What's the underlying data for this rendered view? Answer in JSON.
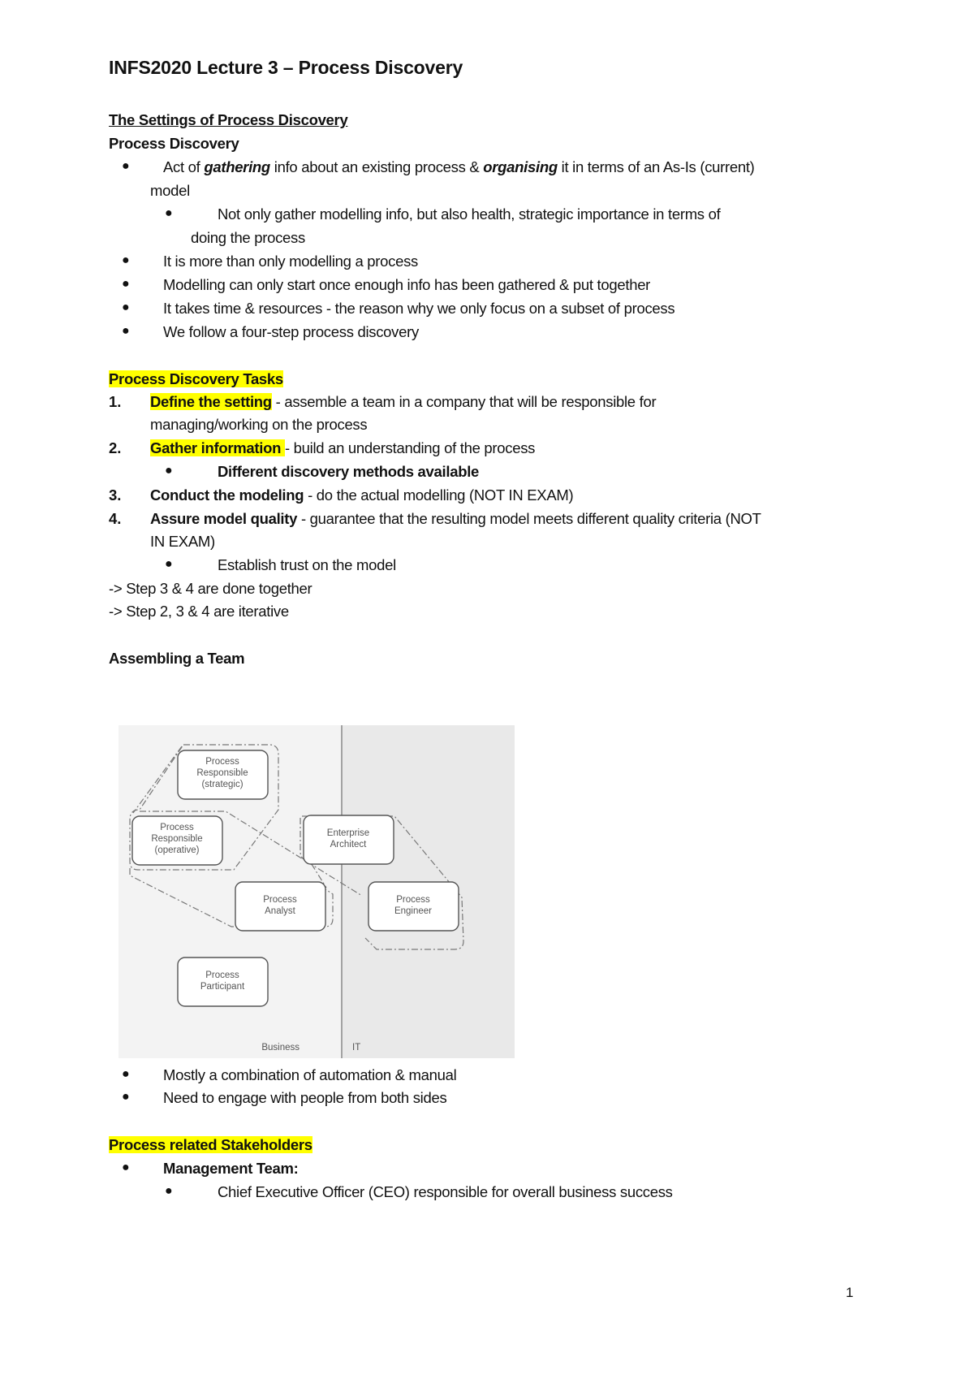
{
  "title": "INFS2020 Lecture 3 – Process Discovery",
  "section1": {
    "heading": "The Settings of Process Discovery",
    "subheading": "Process Discovery",
    "bullets": [
      {
        "parts": [
          "Act of ",
          "gathering",
          " info about an existing process & ",
          "organising",
          " it in terms of an As-Is (current)"
        ],
        "cont": "model",
        "sub": {
          "line1": "Not only gather modelling info, but also health, strategic importance in terms of",
          "line2": "doing the process"
        }
      },
      {
        "text": "It is more than only modelling a process"
      },
      {
        "text": "Modelling can only start once enough info has been gathered & put together"
      },
      {
        "text": "It takes time & resources - the reason why we only focus on a subset of process"
      },
      {
        "text": "We follow a four-step process discovery"
      }
    ]
  },
  "section2": {
    "heading": "Process Discovery Tasks",
    "tasks": [
      {
        "num": "1.",
        "label": "Define the setting",
        "desc": " - assemble a team in a company that will be responsible for",
        "cont": "managing/working on the process"
      },
      {
        "num": "2.",
        "label": "Gather information ",
        "desc": "- build an understanding of the process",
        "sub": "Different discovery methods available"
      },
      {
        "num": "3.",
        "label": "Conduct the modeling",
        "desc": " - do the actual modelling (NOT IN EXAM)"
      },
      {
        "num": "4.",
        "label": "Assure model quality",
        "desc": " - guarantee that the resulting model meets different quality criteria (NOT",
        "cont": "IN EXAM)",
        "sub": "Establish trust on the model"
      }
    ],
    "notes": [
      "-> Step 3 & 4 are done together",
      "-> Step 2, 3 & 4 are iterative"
    ]
  },
  "section3": {
    "heading": "Assembling a Team",
    "diagram": {
      "roles": {
        "strategic": [
          "Process",
          "Responsible",
          "(strategic)"
        ],
        "operative": [
          "Process",
          "Responsible",
          "(operative)"
        ],
        "architect": [
          "Enterprise",
          "Architect"
        ],
        "analyst": [
          "Process",
          "Analyst"
        ],
        "engineer": [
          "Process",
          "Engineer"
        ],
        "participant": [
          "Process",
          "Participant"
        ]
      },
      "business_label": "Business",
      "it_label": "IT"
    },
    "bullets": [
      "Mostly a combination of automation & manual",
      "Need to engage with people from both sides"
    ]
  },
  "section4": {
    "heading": "Process related Stakeholders",
    "bullet": "Management Team:",
    "sub": "Chief Executive Officer (CEO) responsible for overall business success"
  },
  "page_number": "1",
  "colors": {
    "highlight": "#ffff00",
    "business_bg": "#f3f3f3",
    "it_bg": "#e9e9e9"
  }
}
